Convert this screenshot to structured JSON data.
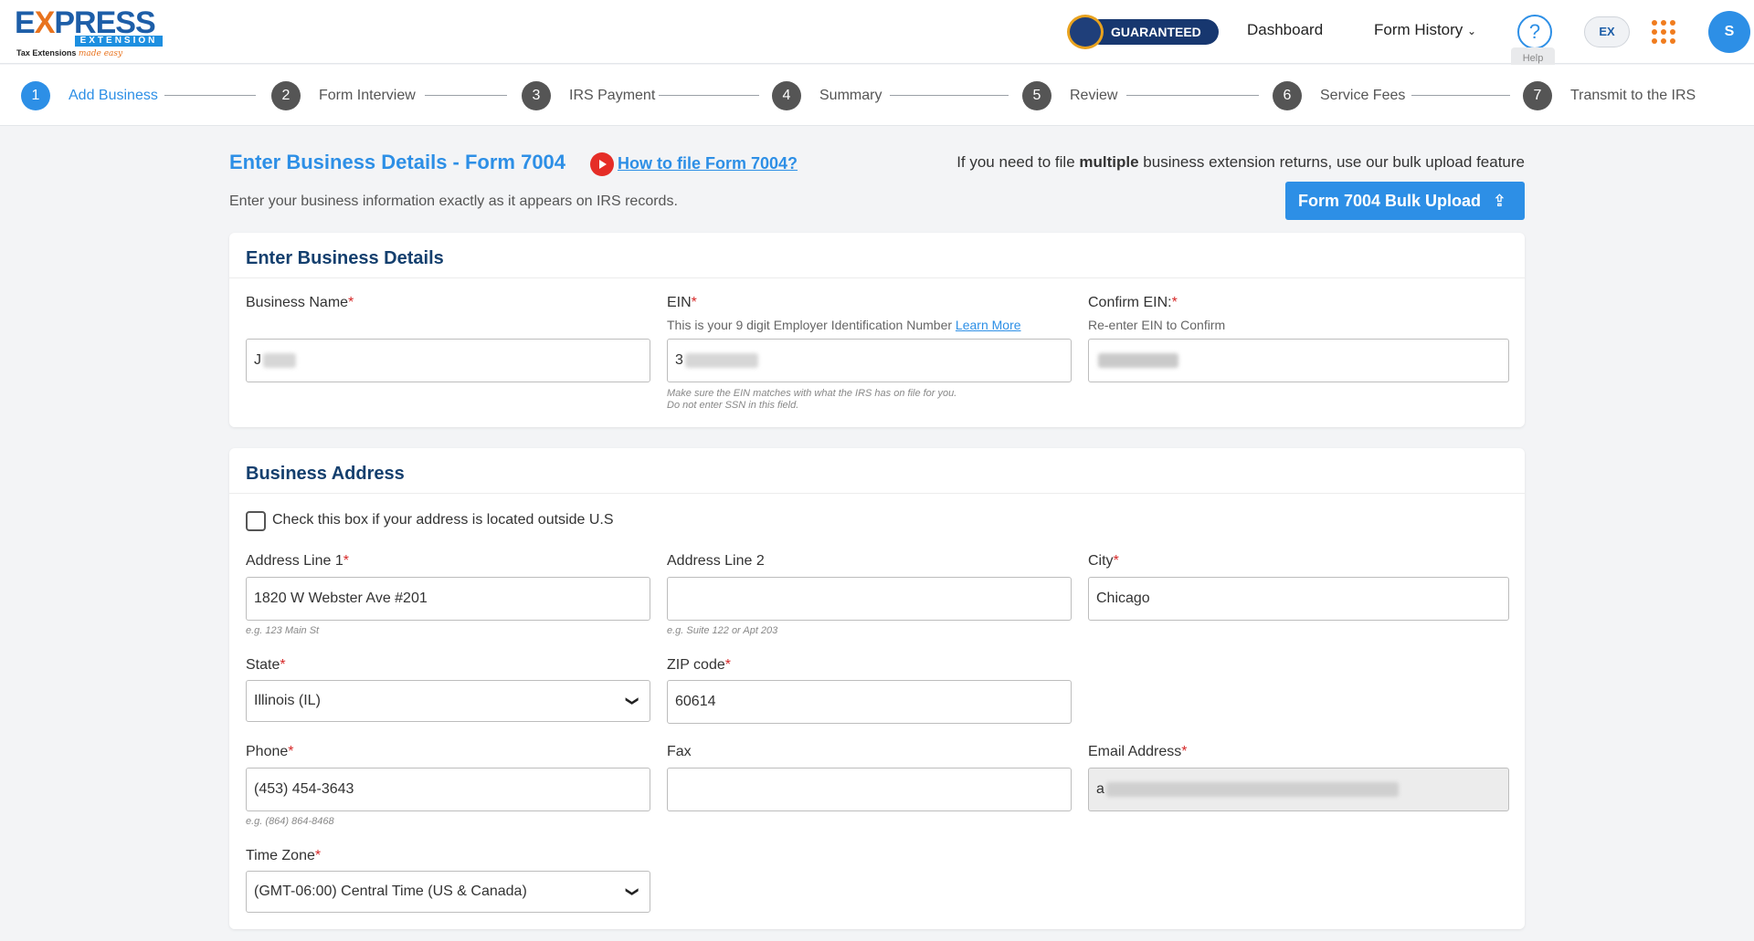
{
  "header": {
    "logo": {
      "main_pre": "E",
      "main_x": "X",
      "main_post": "PRESS",
      "sub": "EXTENSION",
      "tag_plain": "Tax Extensions",
      "tag_script": "made easy"
    },
    "guaranteed": "GUARANTEED",
    "nav": [
      {
        "label": "Dashboard"
      },
      {
        "label": "Form History",
        "has_dropdown": true
      }
    ],
    "help_icon": "?",
    "help_tooltip": "Help",
    "ex_badge": "EX",
    "avatar_letter": "S"
  },
  "stepper": {
    "steps": [
      {
        "num": "1",
        "label": "Add Business",
        "active": true
      },
      {
        "num": "2",
        "label": "Form Interview"
      },
      {
        "num": "3",
        "label": "IRS Payment"
      },
      {
        "num": "4",
        "label": "Summary"
      },
      {
        "num": "5",
        "label": "Review"
      },
      {
        "num": "6",
        "label": "Service Fees"
      },
      {
        "num": "7",
        "label": "Transmit to the IRS"
      }
    ]
  },
  "page": {
    "title": "Enter Business Details - Form 7004",
    "video_link": "How to file Form 7004?",
    "subtitle": "Enter your business information exactly as it appears on IRS records.",
    "bulk_note_pre": "If you need to file ",
    "bulk_note_bold": "multiple",
    "bulk_note_post": " business extension returns, use our bulk upload feature",
    "bulk_button": "Form 7004 Bulk Upload",
    "bulk_icon": "⇪"
  },
  "business_details": {
    "title": "Enter Business Details",
    "business_name": {
      "label": "Business Name",
      "value_prefix": "J"
    },
    "ein": {
      "label": "EIN",
      "hint": "This is your 9 digit Employer Identification Number ",
      "hint_link": "Learn More",
      "value_prefix": "3",
      "help1": "Make sure the EIN matches with what the IRS has on file for you.",
      "help2": "Do not enter SSN in this field."
    },
    "confirm_ein": {
      "label": "Confirm EIN:",
      "hint": "Re-enter EIN to Confirm"
    }
  },
  "business_address": {
    "title": "Business Address",
    "outside_us_label": "Check this box if your address is located outside U.S",
    "outside_us_checked": false,
    "address1": {
      "label": "Address Line 1",
      "value": "1820 W Webster Ave #201",
      "help": "e.g. 123 Main St"
    },
    "address2": {
      "label": "Address Line 2",
      "value": "",
      "help": "e.g. Suite 122 or Apt 203"
    },
    "city": {
      "label": "City",
      "value": "Chicago"
    },
    "state": {
      "label": "State",
      "value": "Illinois (IL)"
    },
    "zip": {
      "label": "ZIP code",
      "value": "60614"
    },
    "phone": {
      "label": "Phone",
      "value": "(453) 454-3643",
      "help": "e.g. (864) 864-8468"
    },
    "fax": {
      "label": "Fax",
      "value": ""
    },
    "email": {
      "label": "Email Address",
      "value_prefix": "a"
    },
    "timezone": {
      "label": "Time Zone",
      "value": "(GMT-06:00) Central Time (US & Canada)"
    }
  },
  "colors": {
    "primary": "#2d8fe6",
    "heading": "#143f6e",
    "required": "#d62828",
    "accent": "#f07c1e"
  }
}
